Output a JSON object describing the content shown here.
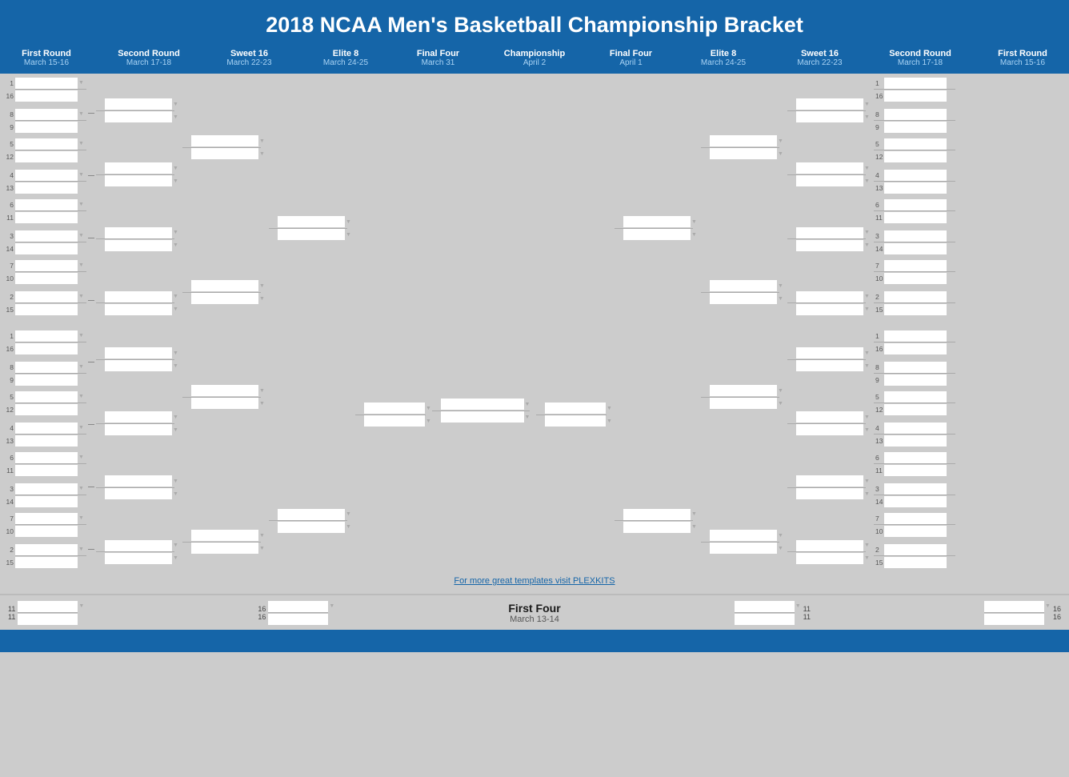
{
  "title": "2018 NCAA Men's Basketball Championship Bracket",
  "rounds": [
    {
      "name": "First Round",
      "date": "March 15-16"
    },
    {
      "name": "Second Round",
      "date": "March 17-18"
    },
    {
      "name": "Sweet 16",
      "date": "March 22-23"
    },
    {
      "name": "Elite 8",
      "date": "March 24-25"
    },
    {
      "name": "Final Four",
      "date": "March 31"
    },
    {
      "name": "Championship",
      "date": "April 2"
    },
    {
      "name": "Final Four",
      "date": "April 1"
    },
    {
      "name": "Elite 8",
      "date": "March 24-25"
    },
    {
      "name": "Sweet 16",
      "date": "March 22-23"
    },
    {
      "name": "Second Round",
      "date": "March 17-18"
    },
    {
      "name": "First Round",
      "date": "March 15-16"
    }
  ],
  "firstFour": {
    "title": "First Four",
    "date": "March 13-14"
  },
  "plexkits": "For more great templates visit PLEXKITS",
  "colors": {
    "header_bg": "#1565a8",
    "bracket_bg": "#cccccc",
    "input_bg": "#ffffff"
  }
}
